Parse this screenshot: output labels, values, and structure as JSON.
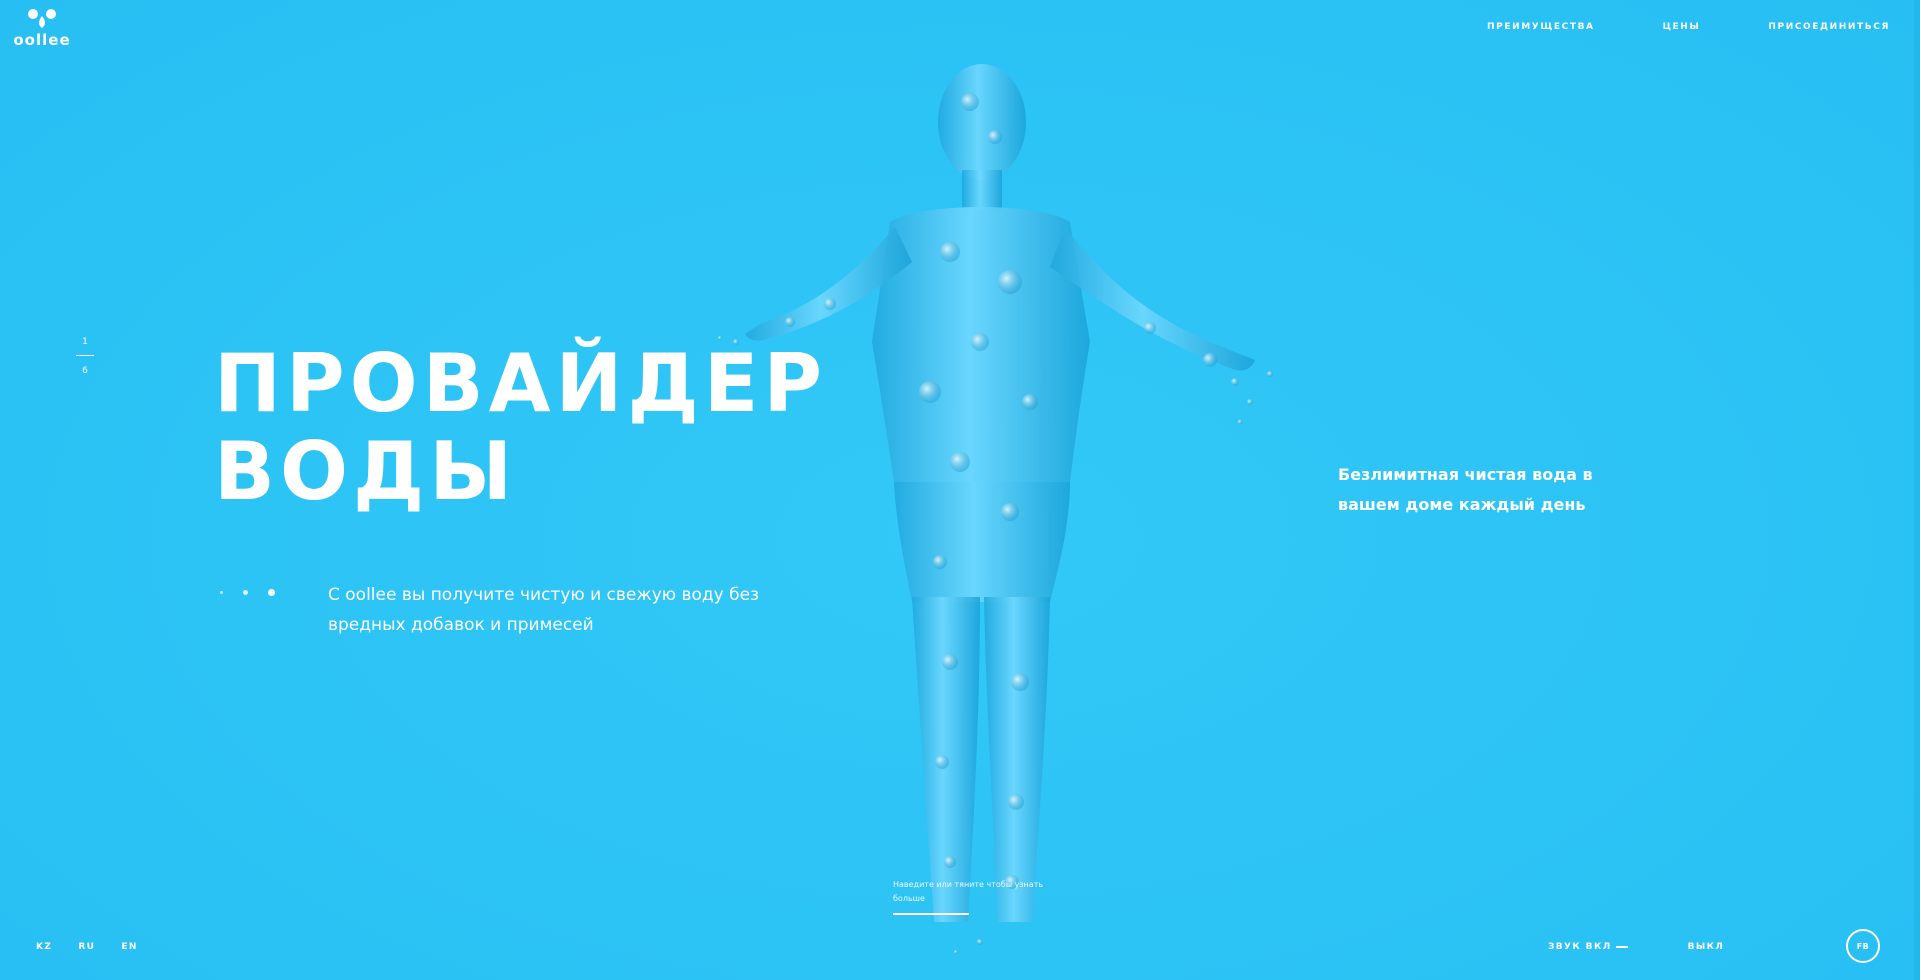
{
  "brand": {
    "name": "oollee",
    "bg_color": "#2ec5f6",
    "text_color": "#ffffff"
  },
  "nav": {
    "items": [
      {
        "label": "ПРЕИМУЩЕСТВА"
      },
      {
        "label": "ЦЕНЫ"
      },
      {
        "label": "ПРИСОЕДИНИТЬСЯ"
      }
    ]
  },
  "slider": {
    "current": "1",
    "total": "6"
  },
  "hero": {
    "title_line1": "ПРОВАЙДЕР",
    "title_line2": "ВОДЫ",
    "intro": "С oollee вы получите чистую и свежую воду без вредных добавок и примесей",
    "side_text": "Безлимитная чистая вода в вашем доме каждый день",
    "hint": "Наведите или тяните чтобы узнать больше"
  },
  "languages": [
    "KZ",
    "RU",
    "EN"
  ],
  "sound": {
    "on_label": "ЗВУК ВКЛ",
    "off_label": "ВЫКЛ"
  },
  "social": {
    "fb_label": "FB"
  },
  "icons": {
    "logo": "water-drops-logo-icon",
    "figure": "water-human-figure-illustration"
  }
}
